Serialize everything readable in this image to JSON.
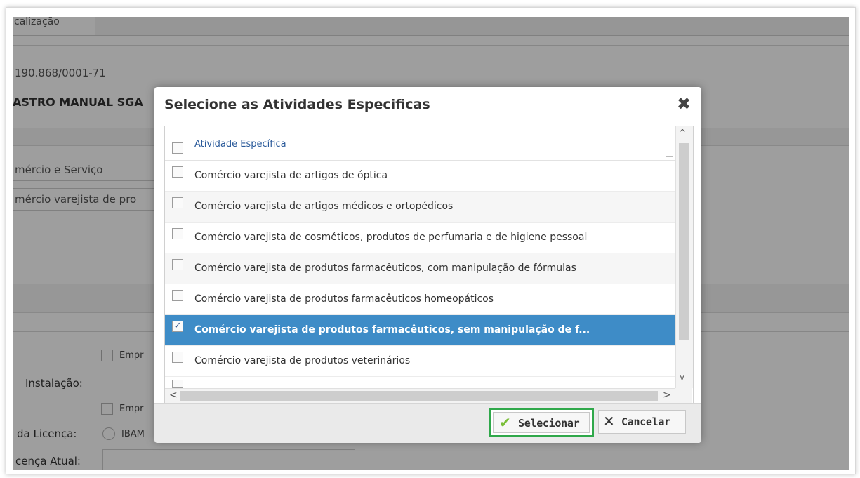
{
  "background": {
    "tab_label": "calização",
    "cnpj": "190.868/0001-71",
    "company_name": "ASTRO MANUAL SGA",
    "sector": "mércio e Serviço",
    "activity": "mércio varejista de pro",
    "checkbox1_label": "Empr",
    "installation_label": "Instalação:",
    "checkbox2_label": "Empr",
    "license_label": "da Licença:",
    "license_option": "IBAM",
    "current_license_label": "cença Atual:"
  },
  "modal": {
    "title": "Selecione as Atividades Especificas",
    "close_icon": "close-x-icon",
    "header_label": "Atividade Específica",
    "rows": [
      {
        "label": "Comércio varejista de artigos de óptica",
        "checked": false
      },
      {
        "label": "Comércio varejista de artigos médicos e ortopédicos",
        "checked": false
      },
      {
        "label": "Comércio varejista de cosméticos, produtos de perfumaria e de higiene pessoal",
        "checked": false
      },
      {
        "label": "Comércio varejista de produtos farmacêuticos, com manipulação de fórmulas",
        "checked": false
      },
      {
        "label": "Comércio varejista de produtos farmacêuticos homeopáticos",
        "checked": false
      },
      {
        "label": "Comércio varejista de produtos farmacêuticos, sem manipulação de f...",
        "checked": true
      },
      {
        "label": "Comércio varejista de produtos veterinários",
        "checked": false
      }
    ],
    "select_button": "Selecionar",
    "cancel_button": "Cancelar"
  },
  "colors": {
    "selected_row": "#3e8cc7",
    "highlight_border": "#2fa84a",
    "check_green": "#7bbf3a"
  }
}
